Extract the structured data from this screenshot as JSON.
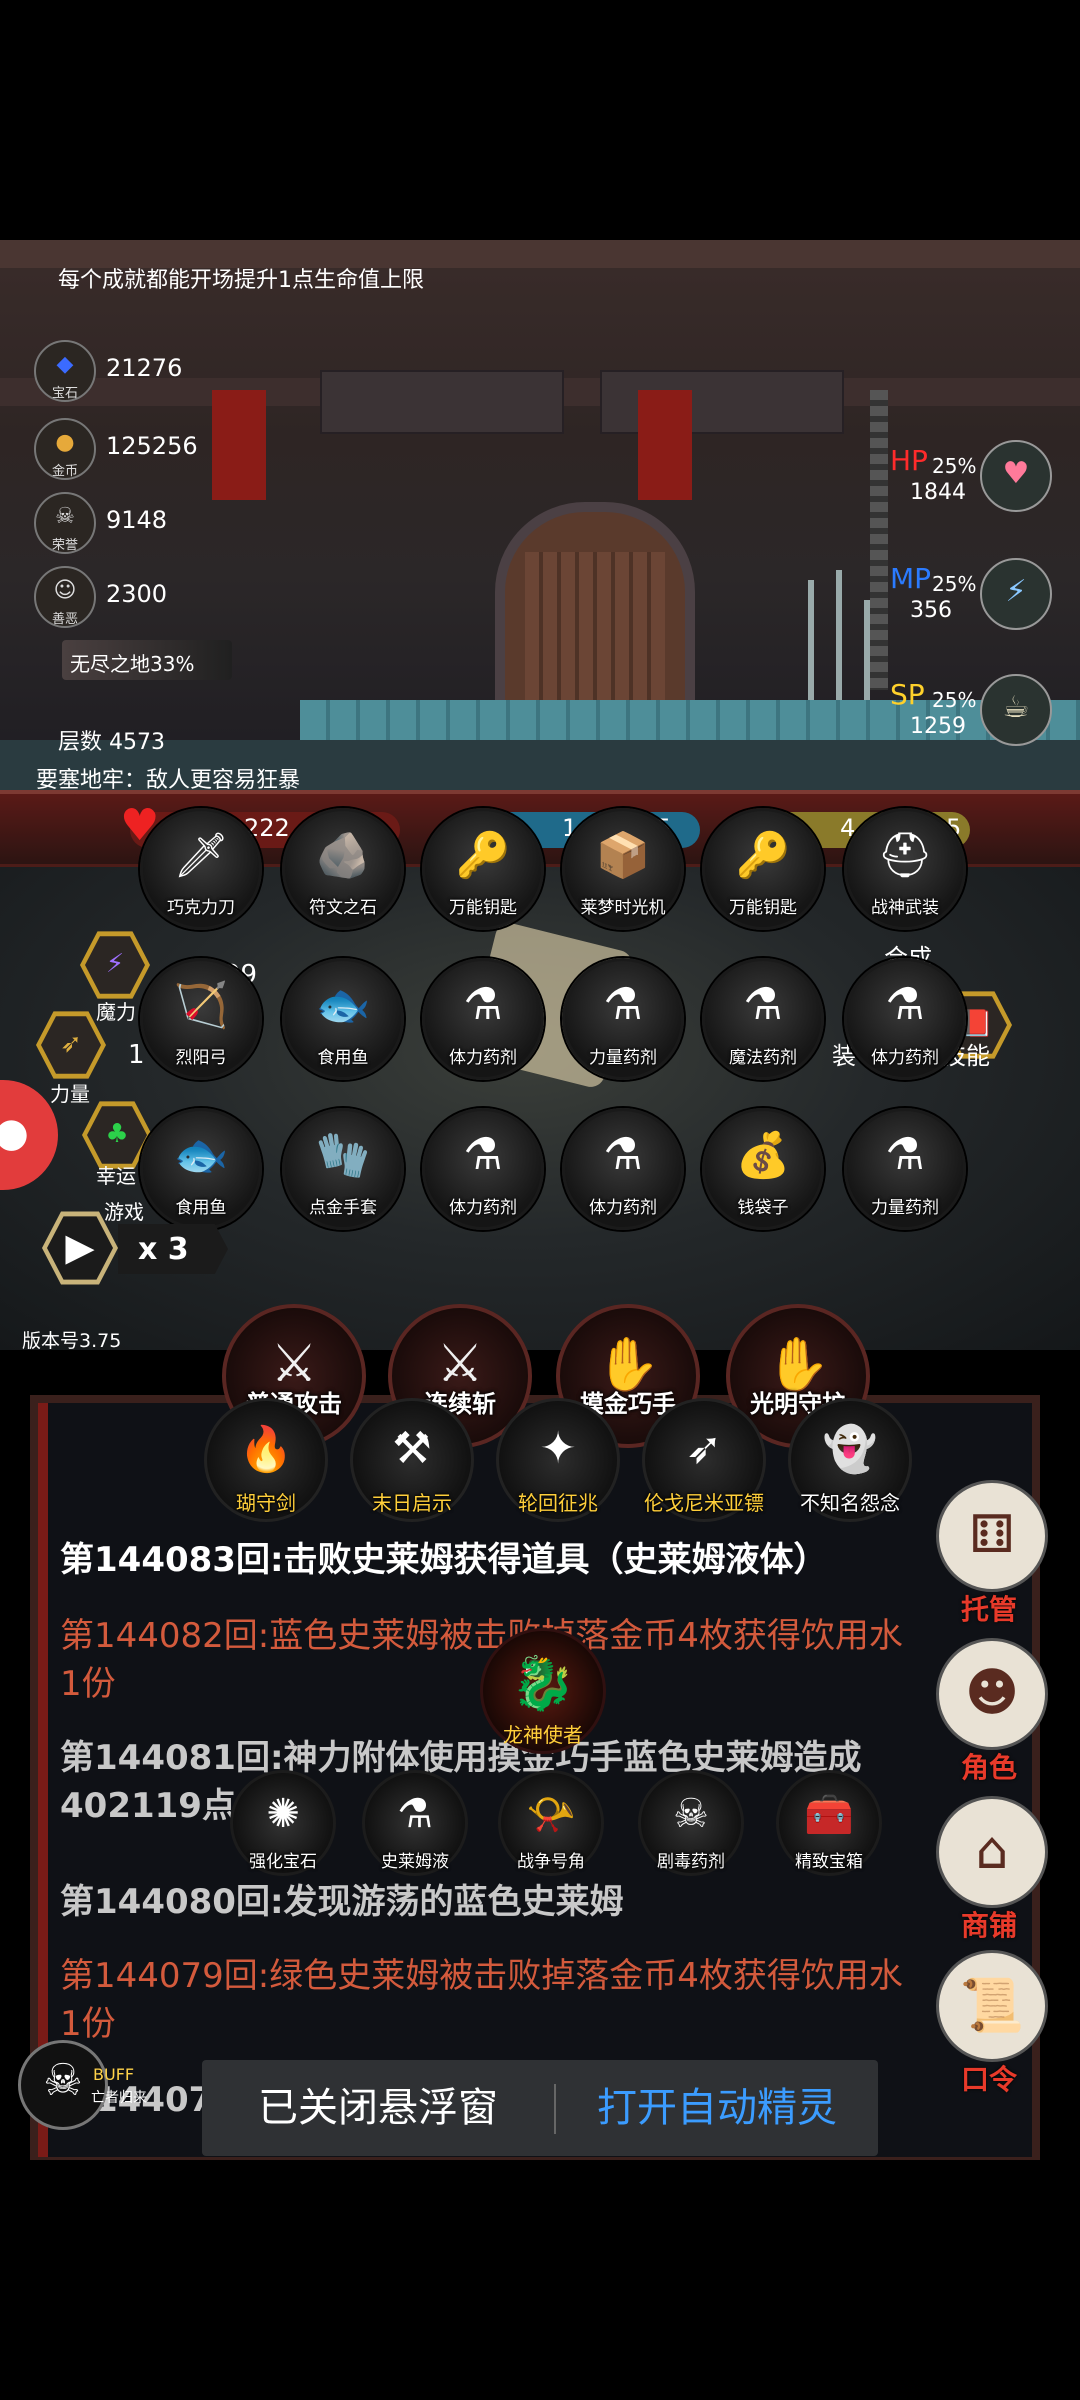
{
  "hud": {
    "hint": "每个成就都能开场提升1点生命值上限",
    "resources": [
      {
        "icon": "gem-icon",
        "glyph": "◆",
        "label": "宝石",
        "value": "21276"
      },
      {
        "icon": "gold-coin-icon",
        "glyph": "●",
        "label": "金币",
        "value": "125256"
      },
      {
        "icon": "skull-icon",
        "glyph": "☠",
        "label": "荣誉",
        "value": "9148"
      },
      {
        "icon": "mask-icon",
        "glyph": "☺",
        "label": "善恶",
        "value": "2300"
      }
    ],
    "depth_label": "无尽之地33%",
    "floor": "层数 4573",
    "curse": "要塞地牢：敌人更容易狂暴",
    "stats": [
      {
        "key": "HP",
        "color": "#ff2b2b",
        "pct": "25%",
        "value": "1844",
        "icon": "hp-potion-icon",
        "glyph": "♥"
      },
      {
        "key": "MP",
        "color": "#2b7bff",
        "pct": "25%",
        "value": "356",
        "icon": "mp-potion-icon",
        "glyph": "⚡"
      },
      {
        "key": "SP",
        "color": "#ffd12b",
        "pct": "25%",
        "value": "1259",
        "icon": "sp-food-icon",
        "glyph": "☕"
      }
    ]
  },
  "statusbar": {
    "heart_value": "222",
    "mid_value": "1",
    "mid_value2": "5",
    "right_value": "4",
    "right_value2": "5",
    "magic_value": "99",
    "power_value": "1"
  },
  "side_labels": {
    "magic": "魔力",
    "power": "力量",
    "luck": "幸运",
    "game": "游戏",
    "synth": "合成",
    "equip": "装",
    "skill": "技能"
  },
  "items": [
    {
      "name": "巧克力刀",
      "icon": "knife-icon",
      "glyph": "🗡"
    },
    {
      "name": "符文之石",
      "icon": "rune-stone-icon",
      "glyph": "🪨"
    },
    {
      "name": "万能钥匙",
      "icon": "key-icon",
      "glyph": "🔑"
    },
    {
      "name": "莱梦时光机",
      "icon": "time-machine-icon",
      "glyph": "📦"
    },
    {
      "name": "万能钥匙",
      "icon": "key-icon",
      "glyph": "🔑"
    },
    {
      "name": "战神武装",
      "icon": "war-armor-icon",
      "glyph": "⛑"
    },
    {
      "name": "烈阳弓",
      "icon": "bow-icon",
      "glyph": "🏹"
    },
    {
      "name": "食用鱼",
      "icon": "fish-icon",
      "glyph": "🐟"
    },
    {
      "name": "体力药剂",
      "icon": "potion-icon",
      "glyph": "⚗"
    },
    {
      "name": "力量药剂",
      "icon": "red-potion-icon",
      "glyph": "⚗"
    },
    {
      "name": "魔法药剂",
      "icon": "potion-icon",
      "glyph": "⚗"
    },
    {
      "name": "体力药剂",
      "icon": "potion-icon",
      "glyph": "⚗"
    },
    {
      "name": "食用鱼",
      "icon": "fish-icon",
      "glyph": "🐟"
    },
    {
      "name": "点金手套",
      "icon": "glove-icon",
      "glyph": "🧤"
    },
    {
      "name": "体力药剂",
      "icon": "potion-icon",
      "glyph": "⚗"
    },
    {
      "name": "体力药剂",
      "icon": "potion-icon",
      "glyph": "⚗"
    },
    {
      "name": "钱袋子",
      "icon": "money-bag-icon",
      "glyph": "💰"
    },
    {
      "name": "力量药剂",
      "icon": "red-potion-icon",
      "glyph": "⚗"
    }
  ],
  "controls": {
    "play": "▶",
    "speed": "x 3",
    "version": "版本号3.75"
  },
  "skills": [
    {
      "name": "普通攻击",
      "glyph": "⚔"
    },
    {
      "name": "连续斩",
      "glyph": "⚔"
    },
    {
      "name": "摸金巧手",
      "glyph": "✋"
    },
    {
      "name": "光明守护",
      "glyph": "✋"
    }
  ],
  "weapons": [
    {
      "name": "瑚守剑",
      "glyph": "🔥",
      "color": "gold"
    },
    {
      "name": "末日启示",
      "glyph": "⚒",
      "color": "gold"
    },
    {
      "name": "轮回征兆",
      "glyph": "✦",
      "color": "gold"
    },
    {
      "name": "伦戈尼米亚镖",
      "glyph": "➶",
      "color": "gold"
    },
    {
      "name": "不知名怨念",
      "glyph": "👻",
      "color": "white"
    }
  ],
  "log": [
    {
      "text": "第144083回:击败史莱姆获得道具（史莱姆液体）",
      "style": "white"
    },
    {
      "text": "第144082回:蓝色史莱姆被击败掉落金币4枚获得饮用水1份",
      "style": "red"
    },
    {
      "text": "第144081回:神力附体使用摸金巧手蓝色史莱姆造成402119点伤害",
      "style": "gray"
    },
    {
      "text": "第144080回:发现游荡的蓝色史莱姆",
      "style": "gray"
    },
    {
      "text": "第144079回:绿色史莱姆被击败掉落金币4枚获得饮用水1份",
      "style": "red"
    },
    {
      "text": "第144078回:发现游荡的绿色史莱姆",
      "style": "gray"
    }
  ],
  "dragon": {
    "name": "龙神使者",
    "glyph": "🐉"
  },
  "drops": [
    {
      "name": "强化宝石",
      "glyph": "✺"
    },
    {
      "name": "史莱姆液",
      "glyph": "⚗"
    },
    {
      "name": "战争号角",
      "glyph": "📯"
    },
    {
      "name": "剧毒药剂",
      "glyph": "☠"
    },
    {
      "name": "精致宝箱",
      "glyph": "🧰"
    }
  ],
  "side_menu": [
    {
      "label": "托管",
      "icon": "dice-icon",
      "glyph": "⚅"
    },
    {
      "label": "角色",
      "icon": "hooded-figure-icon",
      "glyph": "☻"
    },
    {
      "label": "商铺",
      "icon": "shop-icon",
      "glyph": "⌂"
    },
    {
      "label": "口令",
      "icon": "scroll-icon",
      "glyph": "📜"
    }
  ],
  "buff": {
    "label": "BUFF",
    "sub": "亡者归来",
    "glyph": "☠"
  },
  "toast": {
    "left": "已关闭悬浮窗",
    "right": "打开自动精灵"
  }
}
